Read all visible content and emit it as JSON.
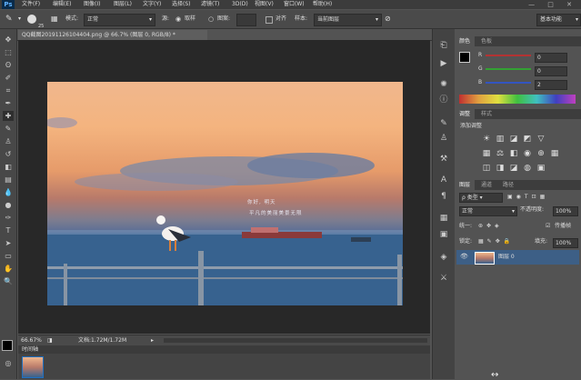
{
  "app": {
    "logo": "Ps"
  },
  "menubar": {
    "items": [
      "文件(F)",
      "编辑(E)",
      "图像(I)",
      "图层(L)",
      "文字(Y)",
      "选择(S)",
      "滤镜(T)",
      "3D(D)",
      "视图(V)",
      "窗口(W)",
      "帮助(H)"
    ],
    "window_controls": "— □ ✕"
  },
  "options": {
    "brush_size": "25",
    "mode_label": "模式:",
    "mode_value": "正常",
    "source_label": "源:",
    "sample_option": "取样",
    "pattern_option": "图案:",
    "aligned_label": "对齐",
    "sample_label": "样本:",
    "sample_value": "当前图层",
    "workspace": "基本功能"
  },
  "document": {
    "tab_title": "QQ截图20191126104404.png @ 66.7% (图层 0, RGB/8) *",
    "zoom": "66.67%",
    "doc_info": "文档:1.72M/1.72M",
    "photo_text_line1": "你好, 明天",
    "photo_text_line2": "平凡的美丽美景无限"
  },
  "timeline": {
    "tab": "时间轴"
  },
  "color_panel": {
    "tabs": [
      "颜色",
      "色板"
    ],
    "r_label": "R",
    "r_value": "0",
    "g_label": "G",
    "g_value": "0",
    "b_label": "B",
    "b_value": "2"
  },
  "adjustments_panel": {
    "tabs": [
      "调整",
      "样式"
    ],
    "title": "添加调整"
  },
  "layers_panel": {
    "tabs": [
      "图层",
      "通道",
      "路径"
    ],
    "filter_label": "类型",
    "blend_mode": "正常",
    "opacity_label": "不透明度:",
    "opacity_value": "100%",
    "unify_label": "统一:",
    "propagate_label": "传播帧",
    "lock_label": "锁定:",
    "fill_label": "填充:",
    "fill_value": "100%",
    "layer_name": "图层 0"
  },
  "colors": {
    "accent": "#1f70c1",
    "menubar_bg": "#3c3c3c",
    "panel_bg": "#535353",
    "canvas_bg": "#282828",
    "red_slider": "#b33333",
    "green_slider": "#33a033",
    "blue_slider": "#3355c0"
  }
}
